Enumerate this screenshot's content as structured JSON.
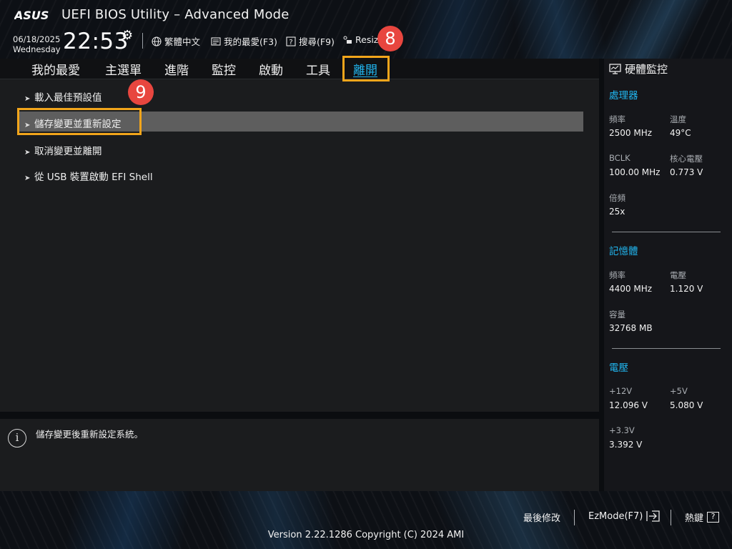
{
  "header": {
    "brand": "ASUS",
    "title": "UEFI BIOS Utility – Advanced Mode",
    "date": "06/18/2025",
    "weekday": "Wednesday",
    "time": "22:53",
    "tools": {
      "language": "繁體中文",
      "favorites": "我的最愛(F3)",
      "search": "搜尋(F9)",
      "resize": "Resiz"
    }
  },
  "annotations": {
    "tab_marker": "8",
    "item_marker": "9",
    "highlight_color": "#f2a51b",
    "marker_color": "#e8463f"
  },
  "tabs": [
    {
      "label": "我的最愛"
    },
    {
      "label": "主選單"
    },
    {
      "label": "進階"
    },
    {
      "label": "監控"
    },
    {
      "label": "啟動"
    },
    {
      "label": "工具"
    },
    {
      "label": "離開",
      "active": true
    }
  ],
  "menu": {
    "items": [
      {
        "label": "載入最佳預設值"
      },
      {
        "label": "儲存變更並重新設定",
        "selected": true
      },
      {
        "label": "取消變更並離開"
      },
      {
        "label": "從 USB 裝置啟動 EFI Shell"
      }
    ]
  },
  "help": {
    "text": "儲存變更後重新設定系統。"
  },
  "monitor": {
    "title": "硬體監控",
    "cpu": {
      "heading": "處理器",
      "freq_label": "頻率",
      "freq": "2500 MHz",
      "temp_label": "溫度",
      "temp": "49°C",
      "bclk_label": "BCLK",
      "bclk": "100.00 MHz",
      "vcore_label": "核心電壓",
      "vcore": "0.773 V",
      "ratio_label": "倍頻",
      "ratio": "25x"
    },
    "memory": {
      "heading": "記憶體",
      "freq_label": "頻率",
      "freq": "4400 MHz",
      "volt_label": "電壓",
      "volt": "1.120 V",
      "cap_label": "容量",
      "cap": "32768 MB"
    },
    "voltage": {
      "heading": "電壓",
      "v12_label": "+12V",
      "v12": "12.096 V",
      "v5_label": "+5V",
      "v5": "5.080 V",
      "v33_label": "+3.3V",
      "v33": "3.392 V"
    }
  },
  "footer": {
    "last_modified": "最後修改",
    "ezmode": "EzMode(F7)",
    "hotkeys": "熱鍵",
    "hotkey_glyph": "?",
    "version": "Version 2.22.1286 Copyright (C) 2024 AMI"
  },
  "colors": {
    "accent": "#21b6f0",
    "selection": "#5e5e5e",
    "panel": "#1b1c1e"
  }
}
